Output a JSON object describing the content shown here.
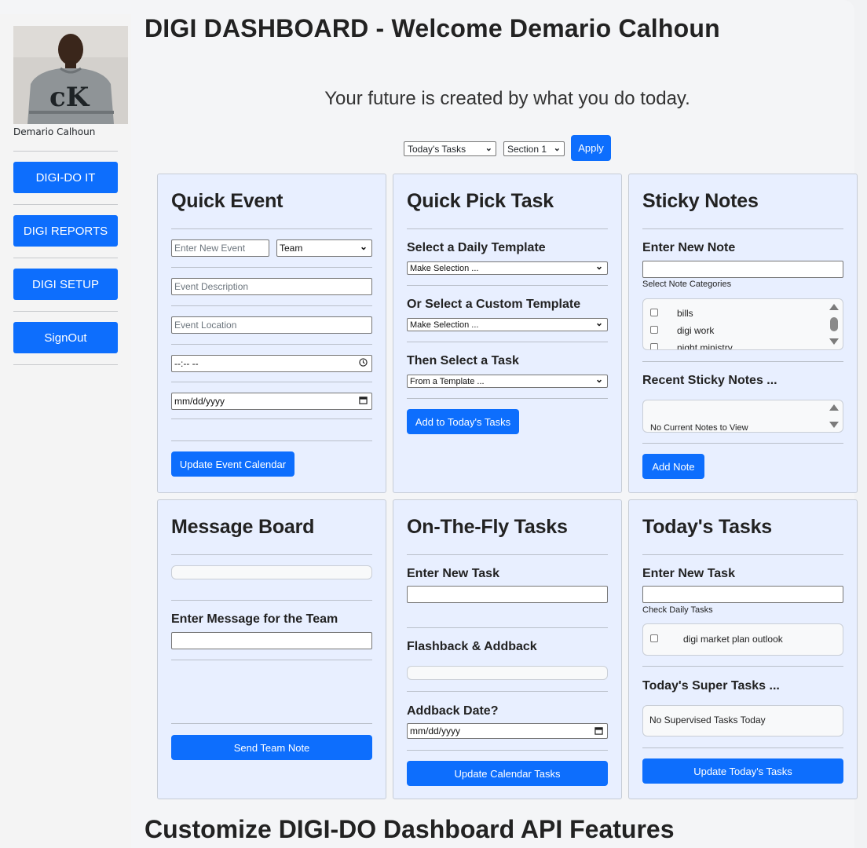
{
  "sidebar": {
    "user_name": "Demario Calhoun",
    "nav": [
      {
        "label": "DIGI-DO IT"
      },
      {
        "label": "DIGI REPORTS"
      },
      {
        "label": "DIGI SETUP"
      },
      {
        "label": "SignOut"
      }
    ]
  },
  "header": {
    "title": "DIGI DASHBOARD - Welcome Demario Calhoun",
    "motto": "Your future is created by what you do today."
  },
  "filter": {
    "view_select": "Today's Tasks",
    "section_select": "Section 1",
    "apply_label": "Apply"
  },
  "quick_event": {
    "title": "Quick Event",
    "event_placeholder": "Enter New Event",
    "team_select": "Team",
    "description_placeholder": "Event Description",
    "location_placeholder": "Event Location",
    "time_value": "--:-- --",
    "date_value": "mm/dd/yyyy",
    "button": "Update Event Calendar"
  },
  "quick_pick": {
    "title": "Quick Pick Task",
    "daily_label": "Select a Daily Template",
    "daily_select": "Make Selection ...",
    "custom_label": "Or Select a Custom Template",
    "custom_select": "Make Selection ...",
    "task_label": "Then Select a Task",
    "task_select": "From a Template ...",
    "button": "Add to Today's Tasks"
  },
  "sticky_notes": {
    "title": "Sticky Notes",
    "new_note_label": "Enter New Note",
    "categories_label": "Select Note Categories",
    "categories": [
      "bills",
      "digi work",
      "night ministry"
    ],
    "recent_label": "Recent Sticky Notes ...",
    "recent_empty": "No Current Notes to View",
    "button": "Add Note"
  },
  "message_board": {
    "title": "Message Board",
    "message_label": "Enter Message for the Team",
    "button": "Send Team Note"
  },
  "on_the_fly": {
    "title": "On-The-Fly Tasks",
    "new_task_label": "Enter New Task",
    "flashback_label": "Flashback & Addback",
    "addback_label": "Addback Date?",
    "date_value": "mm/dd/yyyy",
    "button": "Update Calendar Tasks"
  },
  "todays_tasks": {
    "title": "Today's Tasks",
    "new_task_label": "Enter New Task",
    "check_label": "Check Daily Tasks",
    "daily_tasks": [
      "digi market plan outlook"
    ],
    "super_label": "Today's Super Tasks ...",
    "super_empty": "No Supervised Tasks Today",
    "button": "Update Today's Tasks"
  },
  "footer": {
    "title": "Customize DIGI-DO Dashboard API Features"
  },
  "colors": {
    "accent": "#0d6efd",
    "card_bg": "#e8efff",
    "page_bg": "#f4f5f7"
  }
}
